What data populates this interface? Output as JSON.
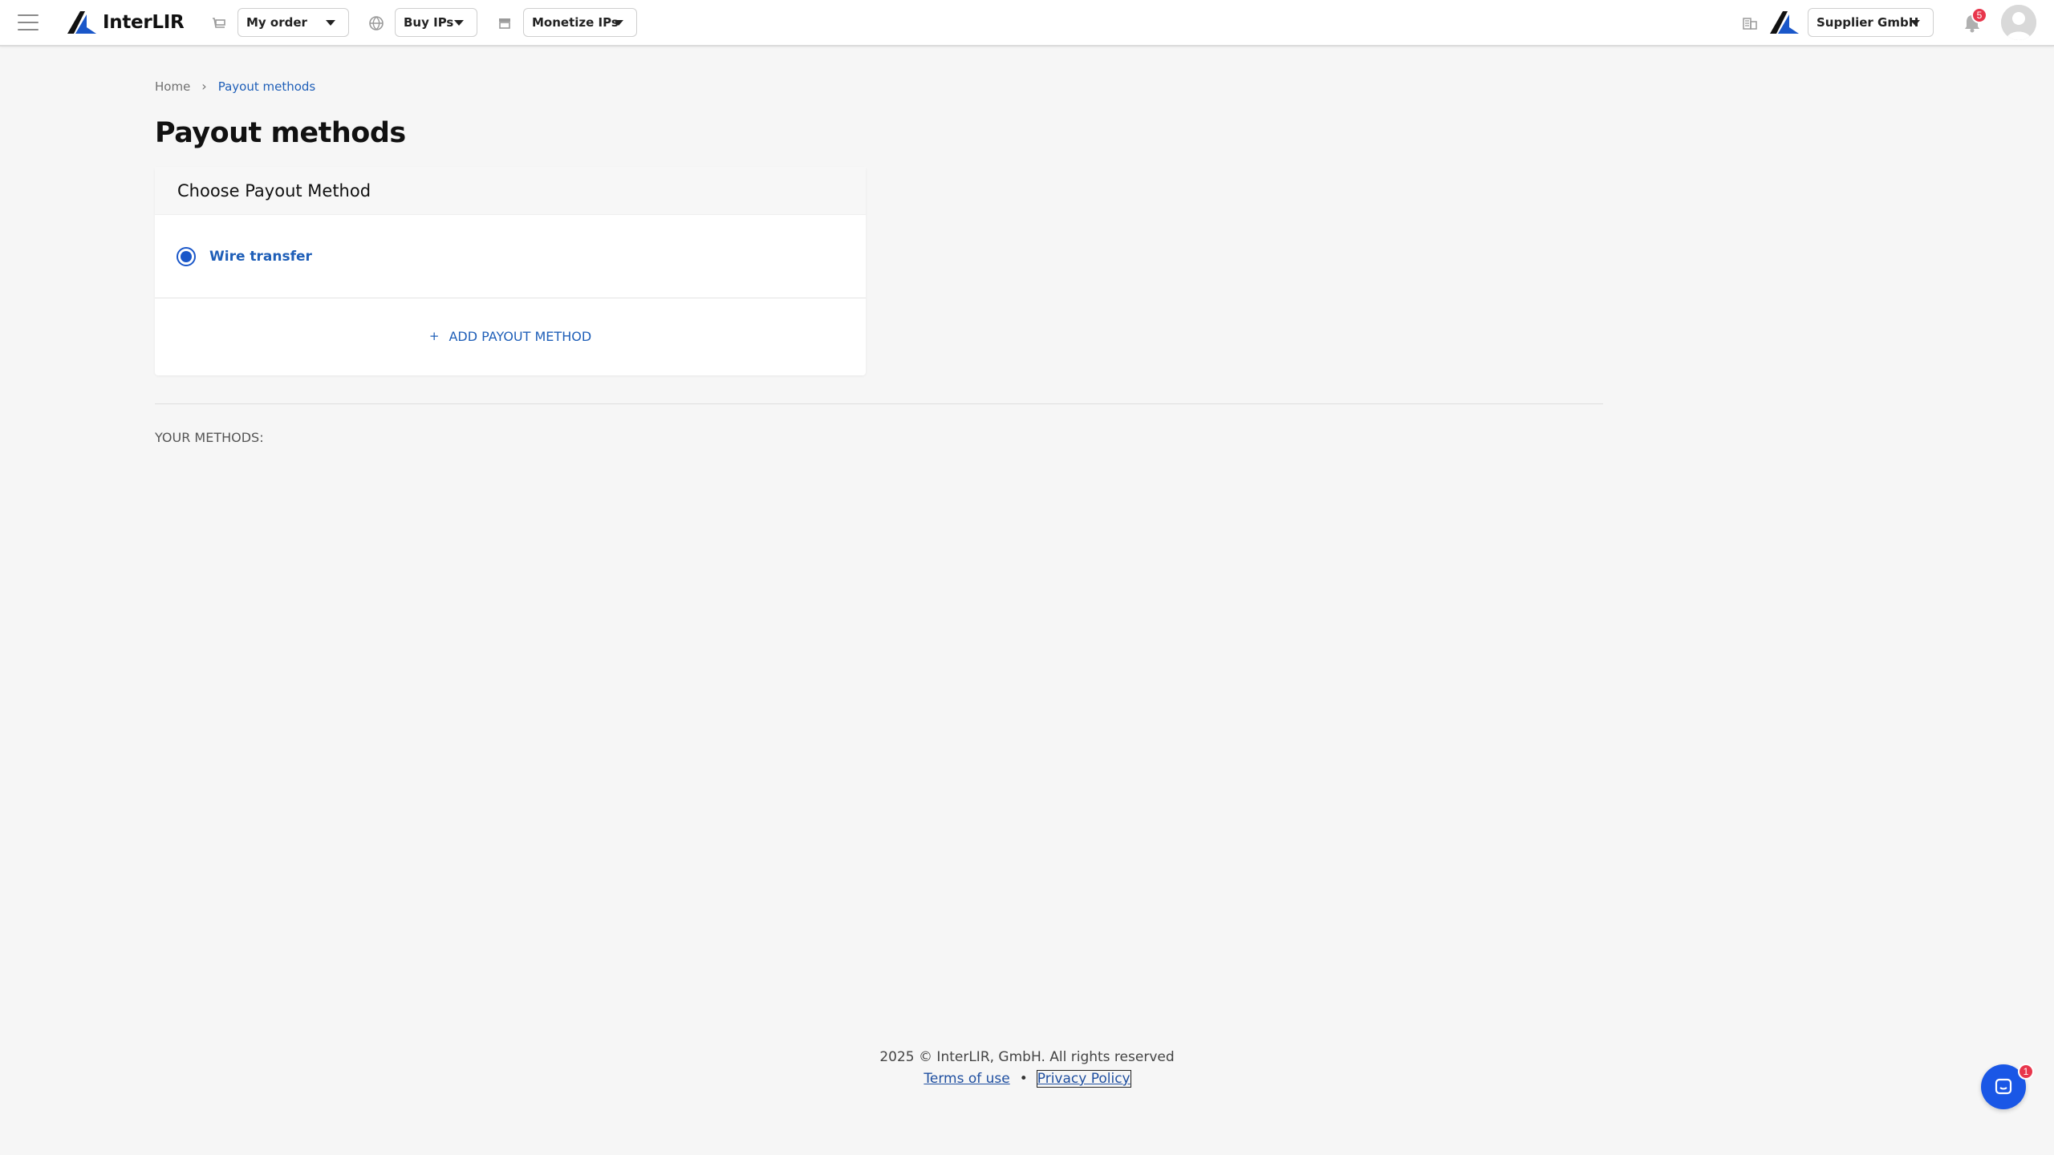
{
  "header": {
    "logo_text": "InterLIR",
    "menu_icon": "hamburger-icon",
    "nav": [
      {
        "icon": "cart-icon",
        "label": "My order"
      },
      {
        "icon": "globe-icon",
        "label": "Buy IPs"
      },
      {
        "icon": "store-icon",
        "label": "Monetize IPs"
      }
    ],
    "company_icon": "building-icon",
    "company_label": "Supplier GmbH",
    "notification_count": "5"
  },
  "breadcrumb": {
    "home": "Home",
    "current": "Payout methods"
  },
  "page_title": "Payout methods",
  "card": {
    "header": "Choose Payout Method",
    "methods": [
      {
        "label": "Wire transfer",
        "selected": true
      }
    ],
    "add_label": "ADD PAYOUT METHOD",
    "add_icon": "+"
  },
  "your_methods_label": "YOUR METHODS:",
  "footer": {
    "copyright": "2025 © InterLIR, GmbH. All rights reserved",
    "terms": "Terms of use",
    "separator": "•",
    "privacy": "Privacy Policy"
  },
  "chat": {
    "icon": "chat-icon",
    "badge": "1"
  },
  "colors": {
    "accent": "#1f5fb8",
    "primary_button": "#1a57e6",
    "badge": "#e8364c",
    "background": "#f6f6f6"
  }
}
